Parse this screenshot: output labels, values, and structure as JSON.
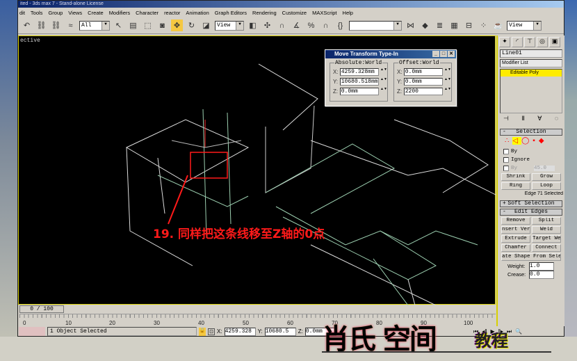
{
  "window": {
    "title": "ited - 3ds max 7 - Stand-alone License"
  },
  "menu": [
    "dit",
    "Tools",
    "Group",
    "Views",
    "Create",
    "Modifiers",
    "Character",
    "reactor",
    "Animation",
    "Graph Editors",
    "Rendering",
    "Customize",
    "MAXScript",
    "Help"
  ],
  "toolbar": {
    "selection_filter": "All",
    "ref_coord": "View",
    "named_sel": "",
    "view_dropdown": "View"
  },
  "viewport": {
    "label": "ective",
    "annotation": "19. 同样把这条线移至Z轴的0点",
    "highlight_color": "#ff0000"
  },
  "dialog": {
    "title": "Move Transform Type-In",
    "absolute": {
      "label": "Absolute:World",
      "x": "4259.328mm",
      "y": "10680.518mm",
      "z": "0.0mm"
    },
    "offset": {
      "label": "Offset:World",
      "x": "0.0mm",
      "y": "0.0mm",
      "z": "2200"
    }
  },
  "command_panel": {
    "object_name": "Line01",
    "modifier_list": "Modifier List",
    "stack_item": "Editable Poly",
    "selection": {
      "title": "Selection",
      "by": "By",
      "ignore": "Ignore",
      "by_angle": "By",
      "angle": "45.0",
      "shrink": "Shrink",
      "grow": "Grow",
      "ring": "Ring",
      "loop": "Loop",
      "status": "Edge 71 Selected"
    },
    "soft_selection": "Soft Selection",
    "edit_edges": {
      "title": "Edit Edges",
      "remove": "Remove",
      "split": "Split",
      "insert": "nsert Verte",
      "weld": "Weld",
      "extrude": "Extrude",
      "target_weld": "Target Wel",
      "chamfer": "Chamfer",
      "connect": "Connect",
      "create_shape": "ate Shape From Selec",
      "weight_label": "Weight:",
      "weight": "1.0",
      "crease_label": "Crease:",
      "crease": "0.0"
    }
  },
  "timeline": {
    "frame": "0 / 100",
    "ticks": [
      "0",
      "10",
      "20",
      "30",
      "40",
      "50",
      "60",
      "70",
      "80",
      "90",
      "100"
    ]
  },
  "status": {
    "message": "1 Object Selected",
    "x": "4259.328",
    "y": "10680.5",
    "z": "0.0mm",
    "x_label": "X:",
    "y_label": "Y:",
    "z_label": "Z:"
  },
  "watermark": {
    "brand": "肖氏 空间",
    "sub": "教程"
  }
}
